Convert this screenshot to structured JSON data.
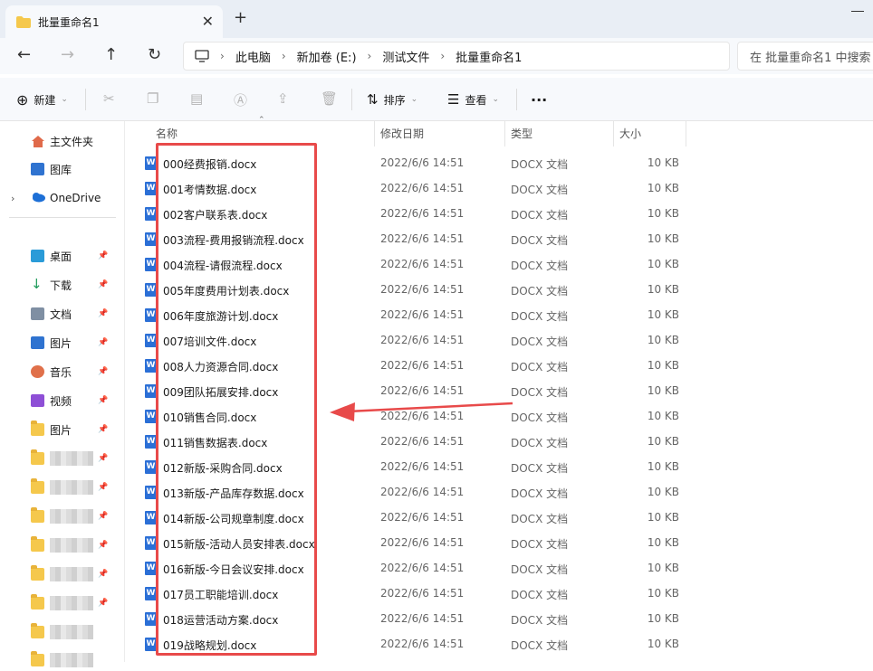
{
  "window": {
    "tab_title": "批量重命名1",
    "new_tab": "+",
    "close": "✕"
  },
  "nav": {
    "back": "←",
    "forward": "→",
    "up": "↑",
    "refresh": "↻",
    "breadcrumbs": [
      "此电脑",
      "新加卷 (E:)",
      "测试文件",
      "批量重命名1"
    ],
    "search_placeholder": "在 批量重命名1 中搜索"
  },
  "commandbar": {
    "new_label": "新建",
    "sort_label": "排序",
    "view_label": "查看",
    "more": "···"
  },
  "sidebar": {
    "top_items": [
      {
        "label": "主文件夹",
        "icon": "home-icon"
      },
      {
        "label": "图库",
        "icon": "gallery-icon"
      },
      {
        "label": "OneDrive",
        "icon": "cloud-icon"
      }
    ],
    "pinned": [
      {
        "label": "桌面",
        "icon": "desktop-icon"
      },
      {
        "label": "下载",
        "icon": "download-icon"
      },
      {
        "label": "文档",
        "icon": "document-icon"
      },
      {
        "label": "图片",
        "icon": "picture-icon"
      },
      {
        "label": "音乐",
        "icon": "music-icon"
      },
      {
        "label": "视频",
        "icon": "video-icon"
      },
      {
        "label": "图片",
        "icon": "folder-icon"
      }
    ],
    "blurred_count": 8
  },
  "columns": {
    "name": "名称",
    "date": "修改日期",
    "type": "类型",
    "size": "大小"
  },
  "files": [
    {
      "name": "000经费报销.docx",
      "date": "2022/6/6 14:51",
      "type": "DOCX 文档",
      "size": "10 KB"
    },
    {
      "name": "001考情数据.docx",
      "date": "2022/6/6 14:51",
      "type": "DOCX 文档",
      "size": "10 KB"
    },
    {
      "name": "002客户联系表.docx",
      "date": "2022/6/6 14:51",
      "type": "DOCX 文档",
      "size": "10 KB"
    },
    {
      "name": "003流程-费用报销流程.docx",
      "date": "2022/6/6 14:51",
      "type": "DOCX 文档",
      "size": "10 KB"
    },
    {
      "name": "004流程-请假流程.docx",
      "date": "2022/6/6 14:51",
      "type": "DOCX 文档",
      "size": "10 KB"
    },
    {
      "name": "005年度费用计划表.docx",
      "date": "2022/6/6 14:51",
      "type": "DOCX 文档",
      "size": "10 KB"
    },
    {
      "name": "006年度旅游计划.docx",
      "date": "2022/6/6 14:51",
      "type": "DOCX 文档",
      "size": "10 KB"
    },
    {
      "name": "007培训文件.docx",
      "date": "2022/6/6 14:51",
      "type": "DOCX 文档",
      "size": "10 KB"
    },
    {
      "name": "008人力资源合同.docx",
      "date": "2022/6/6 14:51",
      "type": "DOCX 文档",
      "size": "10 KB"
    },
    {
      "name": "009团队拓展安排.docx",
      "date": "2022/6/6 14:51",
      "type": "DOCX 文档",
      "size": "10 KB"
    },
    {
      "name": "010销售合同.docx",
      "date": "2022/6/6 14:51",
      "type": "DOCX 文档",
      "size": "10 KB"
    },
    {
      "name": "011销售数据表.docx",
      "date": "2022/6/6 14:51",
      "type": "DOCX 文档",
      "size": "10 KB"
    },
    {
      "name": "012新版-采购合同.docx",
      "date": "2022/6/6 14:51",
      "type": "DOCX 文档",
      "size": "10 KB"
    },
    {
      "name": "013新版-产品库存数据.docx",
      "date": "2022/6/6 14:51",
      "type": "DOCX 文档",
      "size": "10 KB"
    },
    {
      "name": "014新版-公司规章制度.docx",
      "date": "2022/6/6 14:51",
      "type": "DOCX 文档",
      "size": "10 KB"
    },
    {
      "name": "015新版-活动人员安排表.docx",
      "date": "2022/6/6 14:51",
      "type": "DOCX 文档",
      "size": "10 KB"
    },
    {
      "name": "016新版-今日会议安排.docx",
      "date": "2022/6/6 14:51",
      "type": "DOCX 文档",
      "size": "10 KB"
    },
    {
      "name": "017员工职能培训.docx",
      "date": "2022/6/6 14:51",
      "type": "DOCX 文档",
      "size": "10 KB"
    },
    {
      "name": "018运营活动方案.docx",
      "date": "2022/6/6 14:51",
      "type": "DOCX 文档",
      "size": "10 KB"
    },
    {
      "name": "019战略规划.docx",
      "date": "2022/6/6 14:51",
      "type": "DOCX 文档",
      "size": "10 KB"
    }
  ],
  "colors": {
    "annotation": "#e84a4a",
    "word_icon": "#2b6fd6",
    "folder": "#f5c84c"
  }
}
